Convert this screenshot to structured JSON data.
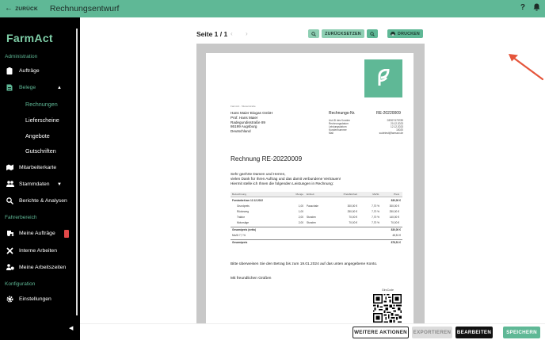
{
  "header": {
    "back_label": "ZURÜCK",
    "title": "Rechnungsentwurf",
    "help_icon": "question-icon",
    "bell_icon": "bell-icon"
  },
  "sidebar": {
    "logo": "FarmAct",
    "sections": {
      "administration": "Administration",
      "fahrerbereich": "Fahrerbereich",
      "konfiguration": "Konfiguration"
    },
    "items": {
      "auftraege": "Aufträge",
      "belege": "Belege",
      "rechnungen": "Rechnungen",
      "lieferscheine": "Lieferscheine",
      "angebote": "Angebote",
      "gutschriften": "Gutschriften",
      "mitarbeiterkarte": "Mitarbeiterkarte",
      "stammdaten": "Stammdaten",
      "berichte": "Berichte & Analysen",
      "meine_auftraege": "Meine Aufträge",
      "interne_arbeiten": "Interne Arbeiten",
      "meine_arbeitszeiten": "Meine Arbeitszeiten",
      "einstellungen": "Einstellungen"
    },
    "badge_color": "#e04848"
  },
  "viewer": {
    "page_label": "Seite 1 / 1",
    "reset_label": "ZURÜCKSETZEN",
    "print_label": "DRUCKEN"
  },
  "invoice": {
    "sender_line": "FarmAct · Musterstraße",
    "recipient": {
      "name": "Hans Maier Biogas GmbH",
      "contact": "Prof. Hans Maier",
      "street": "Radegundisstraße 89",
      "city": "86199 Augsburg",
      "country": "Deutschland"
    },
    "meta_label": "Rechnungs-Nr.",
    "meta_number": "RE-20220009",
    "meta_rows": [
      {
        "label": "Ust-ID des Kunden",
        "value": "DE827475789"
      },
      {
        "label": "Rechnungsdatum",
        "value": "20.12.2023"
      },
      {
        "label": "Leistungsdatum",
        "value": "12.12.2023"
      },
      {
        "label": "Kundennummer",
        "value": "10020"
      },
      {
        "label": "Mail",
        "value": "sudetest@farmact.de"
      }
    ],
    "title": "Rechnung RE-20220009",
    "salutation": "Sehr geehrte Damen und Herren,",
    "intro_1": "vielen Dank für Ihren Auftrag und das damit verbundene Vertrauen!",
    "intro_2": "Hiermit stelle ich Ihnen die folgenden Leistungen in Rechnung:",
    "table_headers": {
      "bez": "Bezeichnung",
      "menge": "Menge",
      "einheit": "Einheit",
      "preis": "Preis/Einheit",
      "mwst": "MwSt.",
      "gesamt": "Preis"
    },
    "group_label": "Forstarbeit am 12.12.2022",
    "group_total": "830,00 €",
    "rows": [
      {
        "bez": "Grundpreis",
        "menge": "1,00",
        "einheit": "Pauschale",
        "preis": "300,00 €",
        "mwst": "7,70 %",
        "gesamt": "300,00 €"
      },
      {
        "bez": "Rückeweg",
        "menge": "1,00",
        "einheit": "",
        "preis": "250,00 €",
        "mwst": "7,70 %",
        "gesamt": "250,00 €"
      },
      {
        "bez": "Traktor",
        "menge": "2,00",
        "einheit": "Stunden",
        "preis": "70,00 €",
        "mwst": "7,70 %",
        "gesamt": "140,00 €"
      },
      {
        "bez": "Motorsäge",
        "menge": "2,00",
        "einheit": "Stunden",
        "preis": "70,00 €",
        "mwst": "7,70 %",
        "gesamt": "70,00 €"
      }
    ],
    "net_label": "Gesamtpreis (netto)",
    "net_value": "830,00 €",
    "vat_label": "MwSt 7,7 %",
    "vat_value": "48,51 €",
    "gross_label": "Gesamtpreis",
    "gross_value": "878,51 €",
    "payment_note": "Bitte überweisen Sie den Betrag bis zum 19.01.2024 auf das unten angegebene Konto.",
    "closing": "Mit freundlichen Grüßen",
    "qr_label": "GiroCode"
  },
  "footer": {
    "more_actions": "WEITERE AKTIONEN",
    "export": "EXPORTIEREN",
    "edit": "BEARBEITEN",
    "save": "SPEICHERN"
  },
  "colors": {
    "accent": "#5fb896",
    "annotation_arrow": "#e5553b"
  }
}
